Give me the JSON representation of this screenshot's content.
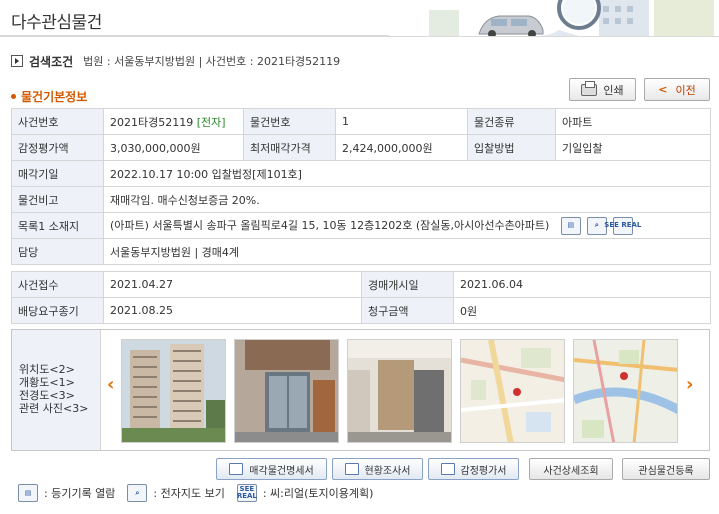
{
  "page": {
    "title": "다수관심물건"
  },
  "search": {
    "label": "검색조건",
    "text": "법원 : 서울동부지방법원 | 사건번호 : 2021타경52119"
  },
  "buttons": {
    "print": "인쇄",
    "prev": "이전"
  },
  "section": {
    "title": "물건기본정보"
  },
  "basic": {
    "case_no_label": "사건번호",
    "case_no": "2021타경52119",
    "electronic": "[전자]",
    "item_no_label": "물건번호",
    "item_no": "1",
    "item_type_label": "물건종류",
    "item_type": "아파트",
    "appraisal_label": "감정평가액",
    "appraisal": "3,030,000,000원",
    "min_price_label": "최저매각가격",
    "min_price": "2,424,000,000원",
    "bid_method_label": "입찰방법",
    "bid_method": "기일입찰",
    "sale_date_label": "매각기일",
    "sale_date": "2022.10.17 10:00 입찰법정[제101호]",
    "remarks_label": "물건비고",
    "remarks": "재매각임. 매수신청보증금 20%.",
    "address_label": "목록1 소재지",
    "address": "(아파트) 서울특별시 송파구 올림픽로4길 15, 10동 12층1202호 (잠실동,아시아선수촌아파트)",
    "manager_label": "담당",
    "manager": "서울동부지방법원 | 경매4계"
  },
  "schedule": {
    "received_label": "사건접수",
    "received": "2021.04.27",
    "start_label": "경매개시일",
    "start": "2021.06.04",
    "deadline_label": "배당요구종기",
    "deadline": "2021.08.25",
    "claim_label": "청구금액",
    "claim": "0원"
  },
  "photos": {
    "labels": [
      "위치도<2>",
      "개황도<1>",
      "전경도<3>",
      "관련 사진<3>"
    ]
  },
  "actions": {
    "sale_statement": "매각물건명세서",
    "status_report": "현황조사서",
    "appraisal_report": "감정평가서",
    "case_detail": "사건상세조회",
    "register_interest": "관심물건등록"
  },
  "legend": {
    "registry": "등기기록 열람",
    "map": "전자지도 보기",
    "real": "씨:리얼(토지이용계획)",
    "real_icon_text": "SEE REAL"
  },
  "colors": {
    "accent": "#d45a00",
    "header_cell": "#eef2f8",
    "electronic": "#2a8a2a"
  }
}
